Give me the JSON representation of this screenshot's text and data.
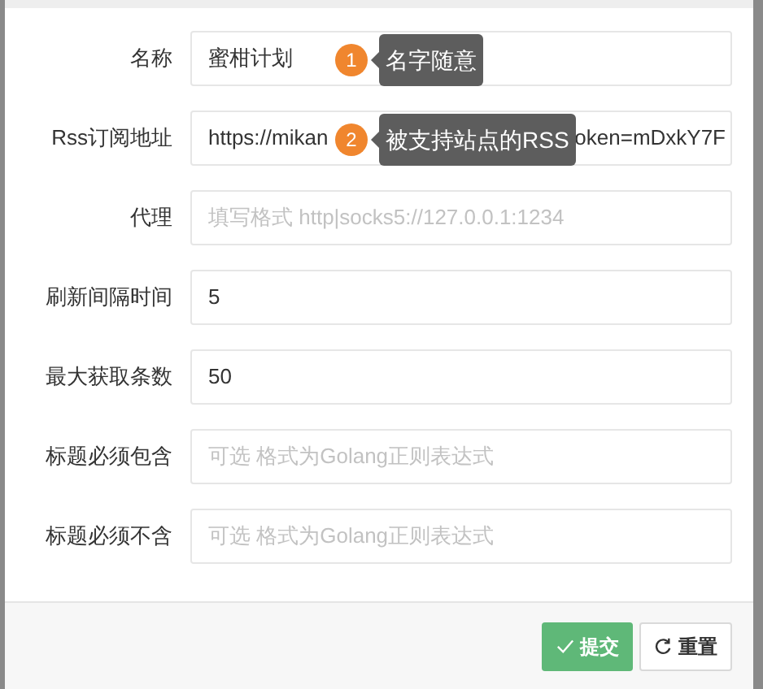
{
  "form": {
    "fields": [
      {
        "label": "名称",
        "value": "蜜柑计划",
        "tip": {
          "number": "1",
          "text": "名字随意"
        }
      },
      {
        "label": "Rss订阅地址",
        "value": "https://mikan",
        "value_tail": "oken=mDxkY7F",
        "tip": {
          "number": "2",
          "text": "被支持站点的RSS"
        }
      },
      {
        "label": "代理",
        "placeholder": "填写格式 http|socks5://127.0.0.1:1234"
      },
      {
        "label": "刷新间隔时间",
        "value": "5"
      },
      {
        "label": "最大获取条数",
        "value": "50"
      },
      {
        "label": "标题必须包含",
        "placeholder": "可选 格式为Golang正则表达式"
      },
      {
        "label": "标题必须不含",
        "placeholder": "可选 格式为Golang正则表达式"
      }
    ]
  },
  "buttons": [
    {
      "kind": "submit",
      "label": "提交"
    },
    {
      "kind": "reset",
      "label": "重置"
    }
  ]
}
